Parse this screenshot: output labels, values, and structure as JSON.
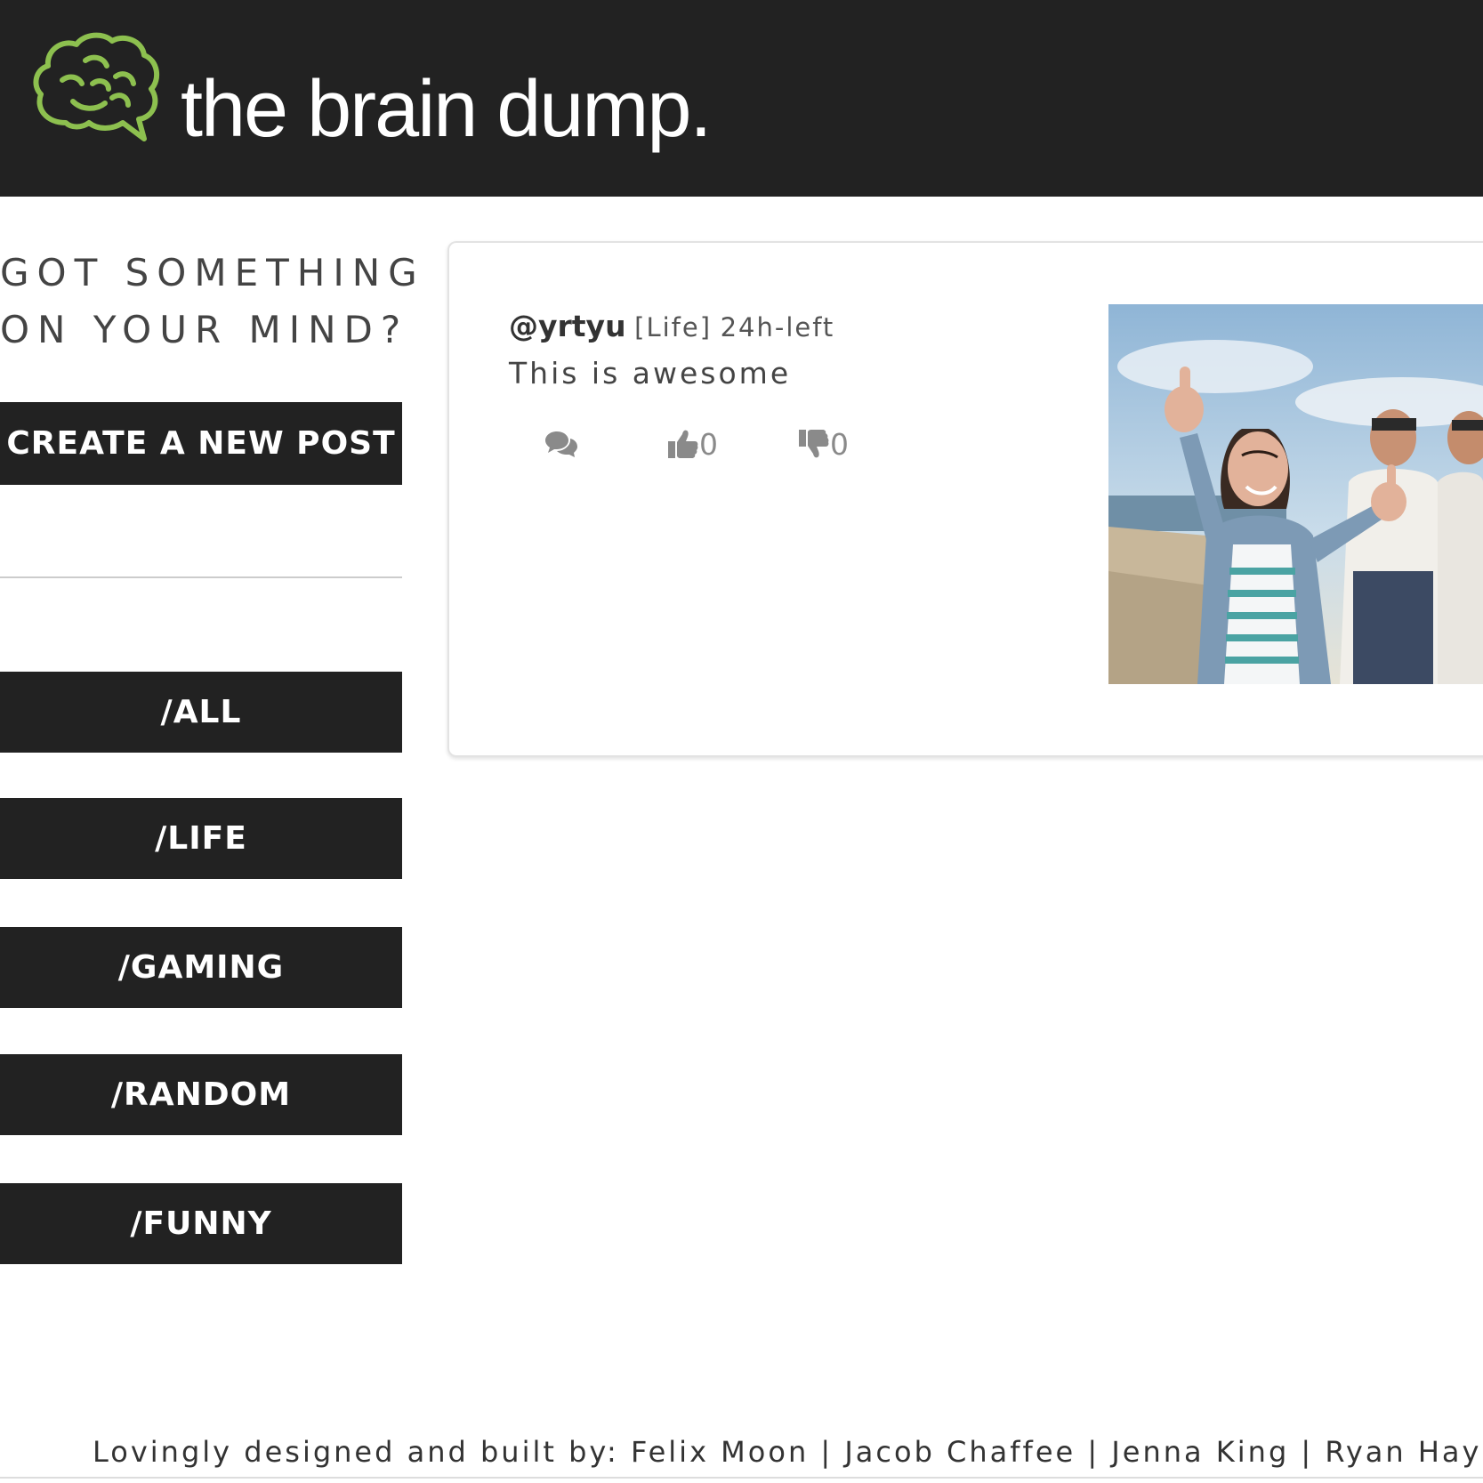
{
  "header": {
    "brand": "the brain dump.",
    "logo_icon": "brain-speech-bubble-icon",
    "logo_color": "#8dc04f",
    "background": "#222222"
  },
  "sidebar": {
    "prompt_line1": "GOT SOMETHING",
    "prompt_line2": "ON YOUR MIND?",
    "create_label": "CREATE A NEW POST",
    "categories": [
      {
        "label": "/ALL"
      },
      {
        "label": "/LIFE"
      },
      {
        "label": "/GAMING"
      },
      {
        "label": "/RANDOM"
      },
      {
        "label": "/FUNNY"
      }
    ]
  },
  "post": {
    "username": "@yrtyu",
    "category": "[Life]",
    "time_left": "24h-left",
    "body": "This is awesome",
    "comment_icon": "comments-icon",
    "upvote_icon": "thumbs-up-icon",
    "upvotes": "0",
    "downvote_icon": "thumbs-down-icon",
    "downvotes": "0"
  },
  "footer": {
    "credits": "Lovingly designed and built by: Felix Moon | Jacob Chaffee | Jenna King | Ryan Hayden | "
  }
}
